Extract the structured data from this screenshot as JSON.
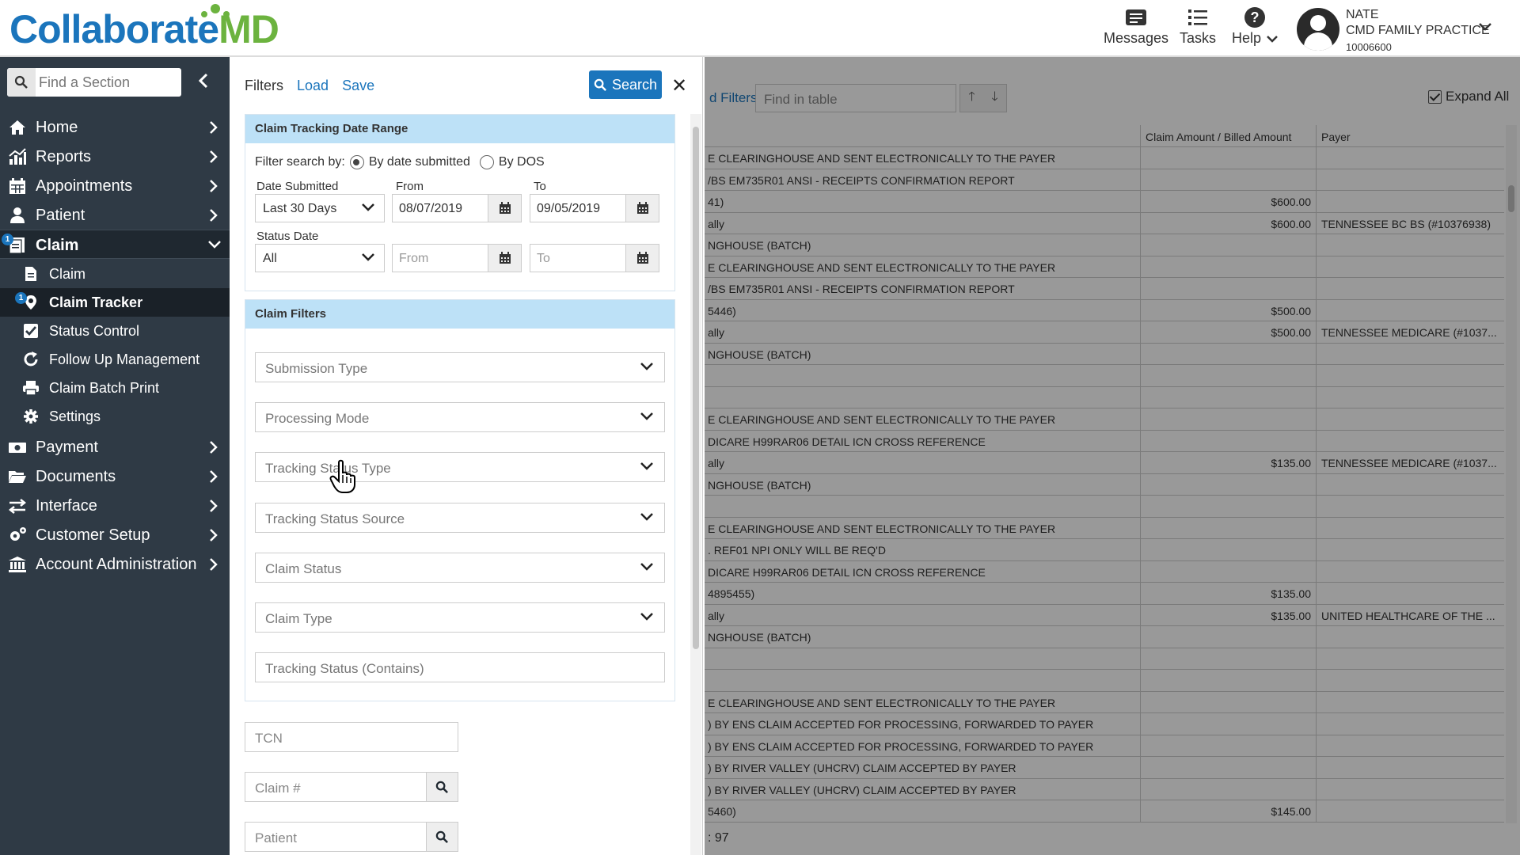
{
  "header": {
    "logo_main": "Collaborate",
    "logo_accent": "MD",
    "messages_label": "Messages",
    "tasks_label": "Tasks",
    "help_label": "Help",
    "user_name": "NATE",
    "user_practice": "CMD FAMILY PRACTICE",
    "user_id": "10006600"
  },
  "sidebar": {
    "search_placeholder": "Find a Section",
    "items": [
      {
        "label": "Home"
      },
      {
        "label": "Reports"
      },
      {
        "label": "Appointments"
      },
      {
        "label": "Patient"
      },
      {
        "label": "Claim",
        "badge": "1"
      },
      {
        "label": "Payment"
      },
      {
        "label": "Documents"
      },
      {
        "label": "Interface"
      },
      {
        "label": "Customer Setup"
      },
      {
        "label": "Account Administration"
      }
    ],
    "claim_sub": [
      {
        "label": "Claim"
      },
      {
        "label": "Claim Tracker",
        "badge": "1"
      },
      {
        "label": "Status Control"
      },
      {
        "label": "Follow Up Management"
      },
      {
        "label": "Claim Batch Print"
      },
      {
        "label": "Settings"
      }
    ]
  },
  "filters": {
    "title": "Filters",
    "load": "Load",
    "save": "Save",
    "search_button": "Search",
    "date_section": {
      "title": "Claim Tracking Date Range",
      "filter_by_label": "Filter search by:",
      "opt_submitted": "By date submitted",
      "opt_dos": "By DOS",
      "date_submitted_label": "Date Submitted",
      "date_submitted_value": "Last 30 Days",
      "from_label": "From",
      "from_value": "08/07/2019",
      "to_label": "To",
      "to_value": "09/05/2019",
      "status_date_label": "Status Date",
      "status_date_value": "All",
      "status_from_placeholder": "From",
      "status_to_placeholder": "To"
    },
    "claim_section": {
      "title": "Claim Filters",
      "dropdowns": [
        "Submission Type",
        "Processing Mode",
        "Tracking Status Type",
        "Tracking Status Source",
        "Claim Status",
        "Claim Type"
      ],
      "tracking_contains_placeholder": "Tracking Status (Contains)"
    },
    "tcn_placeholder": "TCN",
    "claim_no_placeholder": "Claim #",
    "patient_placeholder": "Patient"
  },
  "table": {
    "filters_link": "d Filters",
    "find_placeholder": "Find in table",
    "expand_all": "Expand All",
    "col_amount": "Claim Amount / Billed Amount",
    "col_payer": "Payer",
    "rows": [
      {
        "text": "E CLEARINGHOUSE AND SENT ELECTRONICALLY TO THE PAYER",
        "amount": "",
        "payer": ""
      },
      {
        "text": "/BS EM735R01 ANSI - RECEIPTS CONFIRMATION REPORT",
        "amount": "",
        "payer": ""
      },
      {
        "text": "41)",
        "amount": "$600.00",
        "payer": ""
      },
      {
        "text": "ally",
        "amount": "$600.00",
        "payer": "TENNESSEE BC BS (#10376938)"
      },
      {
        "text": "NGHOUSE (BATCH)",
        "amount": "",
        "payer": ""
      },
      {
        "text": "E CLEARINGHOUSE AND SENT ELECTRONICALLY TO THE PAYER",
        "amount": "",
        "payer": ""
      },
      {
        "text": "/BS EM735R01 ANSI - RECEIPTS CONFIRMATION REPORT",
        "amount": "",
        "payer": ""
      },
      {
        "text": "5446)",
        "amount": "$500.00",
        "payer": ""
      },
      {
        "text": "ally",
        "amount": "$500.00",
        "payer": "TENNESSEE MEDICARE (#1037..."
      },
      {
        "text": "NGHOUSE (BATCH)",
        "amount": "",
        "payer": ""
      },
      {
        "text": "",
        "amount": "",
        "payer": ""
      },
      {
        "text": "",
        "amount": "",
        "payer": ""
      },
      {
        "text": "E CLEARINGHOUSE AND SENT ELECTRONICALLY TO THE PAYER",
        "amount": "",
        "payer": ""
      },
      {
        "text": "DICARE H99RAR06 DETAIL ICN CROSS REFERENCE",
        "amount": "",
        "payer": ""
      },
      {
        "text": "ally",
        "amount": "$135.00",
        "payer": "TENNESSEE MEDICARE (#1037..."
      },
      {
        "text": "NGHOUSE (BATCH)",
        "amount": "",
        "payer": ""
      },
      {
        "text": "",
        "amount": "",
        "payer": ""
      },
      {
        "text": "E CLEARINGHOUSE AND SENT ELECTRONICALLY TO THE PAYER",
        "amount": "",
        "payer": ""
      },
      {
        "text": ". REF01 NPI ONLY WILL BE REQ'D",
        "amount": "",
        "payer": ""
      },
      {
        "text": "DICARE H99RAR06 DETAIL ICN CROSS REFERENCE",
        "amount": "",
        "payer": ""
      },
      {
        "text": "4895455)",
        "amount": "$135.00",
        "payer": ""
      },
      {
        "text": "ally",
        "amount": "$135.00",
        "payer": "UNITED HEALTHCARE OF THE ..."
      },
      {
        "text": "NGHOUSE (BATCH)",
        "amount": "",
        "payer": ""
      },
      {
        "text": "",
        "amount": "",
        "payer": ""
      },
      {
        "text": "",
        "amount": "",
        "payer": ""
      },
      {
        "text": "E CLEARINGHOUSE AND SENT ELECTRONICALLY TO THE PAYER",
        "amount": "",
        "payer": ""
      },
      {
        "text": ") BY ENS CLAIM ACCEPTED FOR PROCESSING, FORWARDED TO PAYER",
        "amount": "",
        "payer": ""
      },
      {
        "text": ") BY ENS CLAIM ACCEPTED FOR PROCESSING, FORWARDED TO PAYER",
        "amount": "",
        "payer": ""
      },
      {
        "text": ") BY RIVER VALLEY (UHCRV) CLAIM ACCEPTED BY PAYER",
        "amount": "",
        "payer": ""
      },
      {
        "text": ") BY RIVER VALLEY (UHCRV) CLAIM ACCEPTED BY PAYER",
        "amount": "",
        "payer": ""
      },
      {
        "text": "5460)",
        "amount": "$145.00",
        "payer": ""
      }
    ],
    "footer": ": 97"
  }
}
